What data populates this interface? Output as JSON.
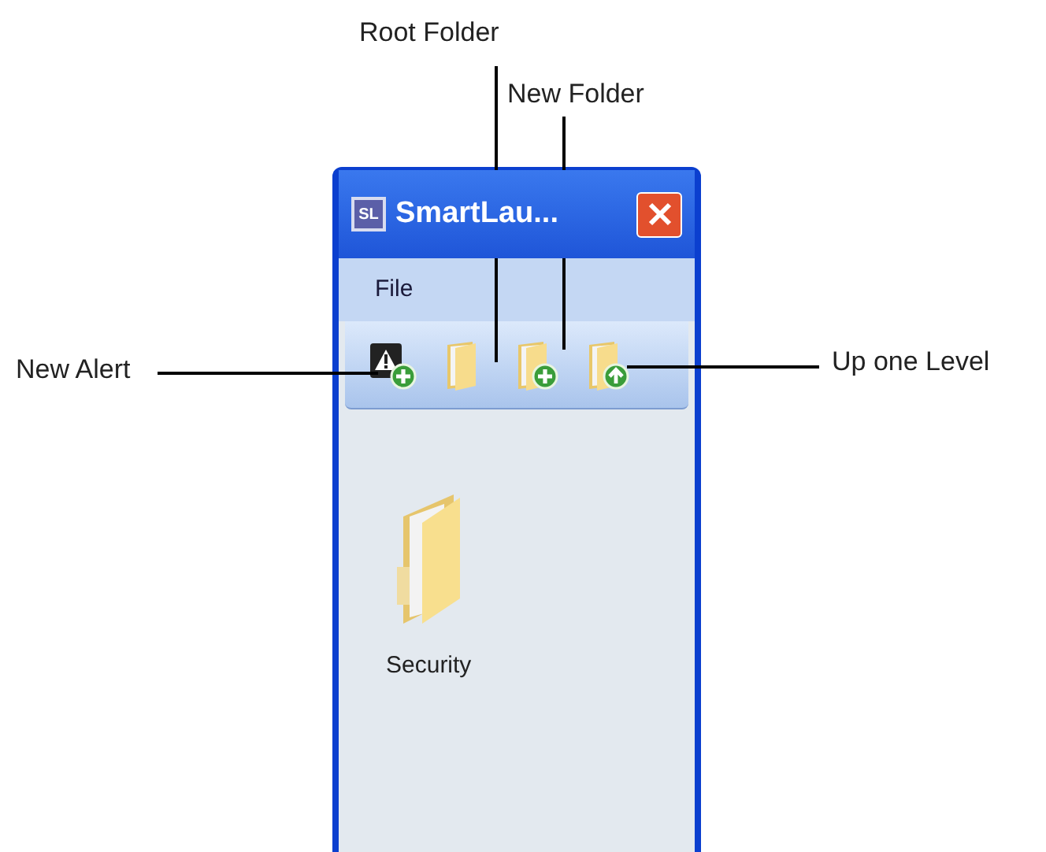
{
  "window": {
    "title": "SmartLau...",
    "app_icon": "SL"
  },
  "menu": [
    {
      "label": "File"
    }
  ],
  "toolbar": [
    {
      "kind": "new-alert"
    },
    {
      "kind": "root-folder"
    },
    {
      "kind": "new-folder"
    },
    {
      "kind": "up-level"
    }
  ],
  "items": [
    {
      "label": "Security"
    }
  ],
  "annotations": [
    {
      "label": "Root Folder"
    },
    {
      "label": "New Folder"
    },
    {
      "label": "New Alert"
    },
    {
      "label": "Up one Level"
    }
  ]
}
